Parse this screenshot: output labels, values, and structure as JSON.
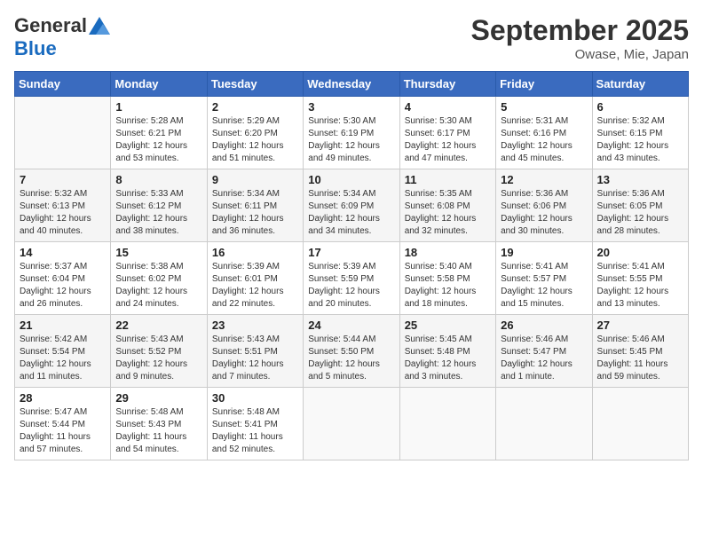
{
  "header": {
    "logo_general": "General",
    "logo_blue": "Blue",
    "title": "September 2025",
    "location": "Owase, Mie, Japan"
  },
  "weekdays": [
    "Sunday",
    "Monday",
    "Tuesday",
    "Wednesday",
    "Thursday",
    "Friday",
    "Saturday"
  ],
  "weeks": [
    [
      {
        "day": "",
        "info": ""
      },
      {
        "day": "1",
        "info": "Sunrise: 5:28 AM\nSunset: 6:21 PM\nDaylight: 12 hours\nand 53 minutes."
      },
      {
        "day": "2",
        "info": "Sunrise: 5:29 AM\nSunset: 6:20 PM\nDaylight: 12 hours\nand 51 minutes."
      },
      {
        "day": "3",
        "info": "Sunrise: 5:30 AM\nSunset: 6:19 PM\nDaylight: 12 hours\nand 49 minutes."
      },
      {
        "day": "4",
        "info": "Sunrise: 5:30 AM\nSunset: 6:17 PM\nDaylight: 12 hours\nand 47 minutes."
      },
      {
        "day": "5",
        "info": "Sunrise: 5:31 AM\nSunset: 6:16 PM\nDaylight: 12 hours\nand 45 minutes."
      },
      {
        "day": "6",
        "info": "Sunrise: 5:32 AM\nSunset: 6:15 PM\nDaylight: 12 hours\nand 43 minutes."
      }
    ],
    [
      {
        "day": "7",
        "info": "Sunrise: 5:32 AM\nSunset: 6:13 PM\nDaylight: 12 hours\nand 40 minutes."
      },
      {
        "day": "8",
        "info": "Sunrise: 5:33 AM\nSunset: 6:12 PM\nDaylight: 12 hours\nand 38 minutes."
      },
      {
        "day": "9",
        "info": "Sunrise: 5:34 AM\nSunset: 6:11 PM\nDaylight: 12 hours\nand 36 minutes."
      },
      {
        "day": "10",
        "info": "Sunrise: 5:34 AM\nSunset: 6:09 PM\nDaylight: 12 hours\nand 34 minutes."
      },
      {
        "day": "11",
        "info": "Sunrise: 5:35 AM\nSunset: 6:08 PM\nDaylight: 12 hours\nand 32 minutes."
      },
      {
        "day": "12",
        "info": "Sunrise: 5:36 AM\nSunset: 6:06 PM\nDaylight: 12 hours\nand 30 minutes."
      },
      {
        "day": "13",
        "info": "Sunrise: 5:36 AM\nSunset: 6:05 PM\nDaylight: 12 hours\nand 28 minutes."
      }
    ],
    [
      {
        "day": "14",
        "info": "Sunrise: 5:37 AM\nSunset: 6:04 PM\nDaylight: 12 hours\nand 26 minutes."
      },
      {
        "day": "15",
        "info": "Sunrise: 5:38 AM\nSunset: 6:02 PM\nDaylight: 12 hours\nand 24 minutes."
      },
      {
        "day": "16",
        "info": "Sunrise: 5:39 AM\nSunset: 6:01 PM\nDaylight: 12 hours\nand 22 minutes."
      },
      {
        "day": "17",
        "info": "Sunrise: 5:39 AM\nSunset: 5:59 PM\nDaylight: 12 hours\nand 20 minutes."
      },
      {
        "day": "18",
        "info": "Sunrise: 5:40 AM\nSunset: 5:58 PM\nDaylight: 12 hours\nand 18 minutes."
      },
      {
        "day": "19",
        "info": "Sunrise: 5:41 AM\nSunset: 5:57 PM\nDaylight: 12 hours\nand 15 minutes."
      },
      {
        "day": "20",
        "info": "Sunrise: 5:41 AM\nSunset: 5:55 PM\nDaylight: 12 hours\nand 13 minutes."
      }
    ],
    [
      {
        "day": "21",
        "info": "Sunrise: 5:42 AM\nSunset: 5:54 PM\nDaylight: 12 hours\nand 11 minutes."
      },
      {
        "day": "22",
        "info": "Sunrise: 5:43 AM\nSunset: 5:52 PM\nDaylight: 12 hours\nand 9 minutes."
      },
      {
        "day": "23",
        "info": "Sunrise: 5:43 AM\nSunset: 5:51 PM\nDaylight: 12 hours\nand 7 minutes."
      },
      {
        "day": "24",
        "info": "Sunrise: 5:44 AM\nSunset: 5:50 PM\nDaylight: 12 hours\nand 5 minutes."
      },
      {
        "day": "25",
        "info": "Sunrise: 5:45 AM\nSunset: 5:48 PM\nDaylight: 12 hours\nand 3 minutes."
      },
      {
        "day": "26",
        "info": "Sunrise: 5:46 AM\nSunset: 5:47 PM\nDaylight: 12 hours\nand 1 minute."
      },
      {
        "day": "27",
        "info": "Sunrise: 5:46 AM\nSunset: 5:45 PM\nDaylight: 11 hours\nand 59 minutes."
      }
    ],
    [
      {
        "day": "28",
        "info": "Sunrise: 5:47 AM\nSunset: 5:44 PM\nDaylight: 11 hours\nand 57 minutes."
      },
      {
        "day": "29",
        "info": "Sunrise: 5:48 AM\nSunset: 5:43 PM\nDaylight: 11 hours\nand 54 minutes."
      },
      {
        "day": "30",
        "info": "Sunrise: 5:48 AM\nSunset: 5:41 PM\nDaylight: 11 hours\nand 52 minutes."
      },
      {
        "day": "",
        "info": ""
      },
      {
        "day": "",
        "info": ""
      },
      {
        "day": "",
        "info": ""
      },
      {
        "day": "",
        "info": ""
      }
    ]
  ]
}
